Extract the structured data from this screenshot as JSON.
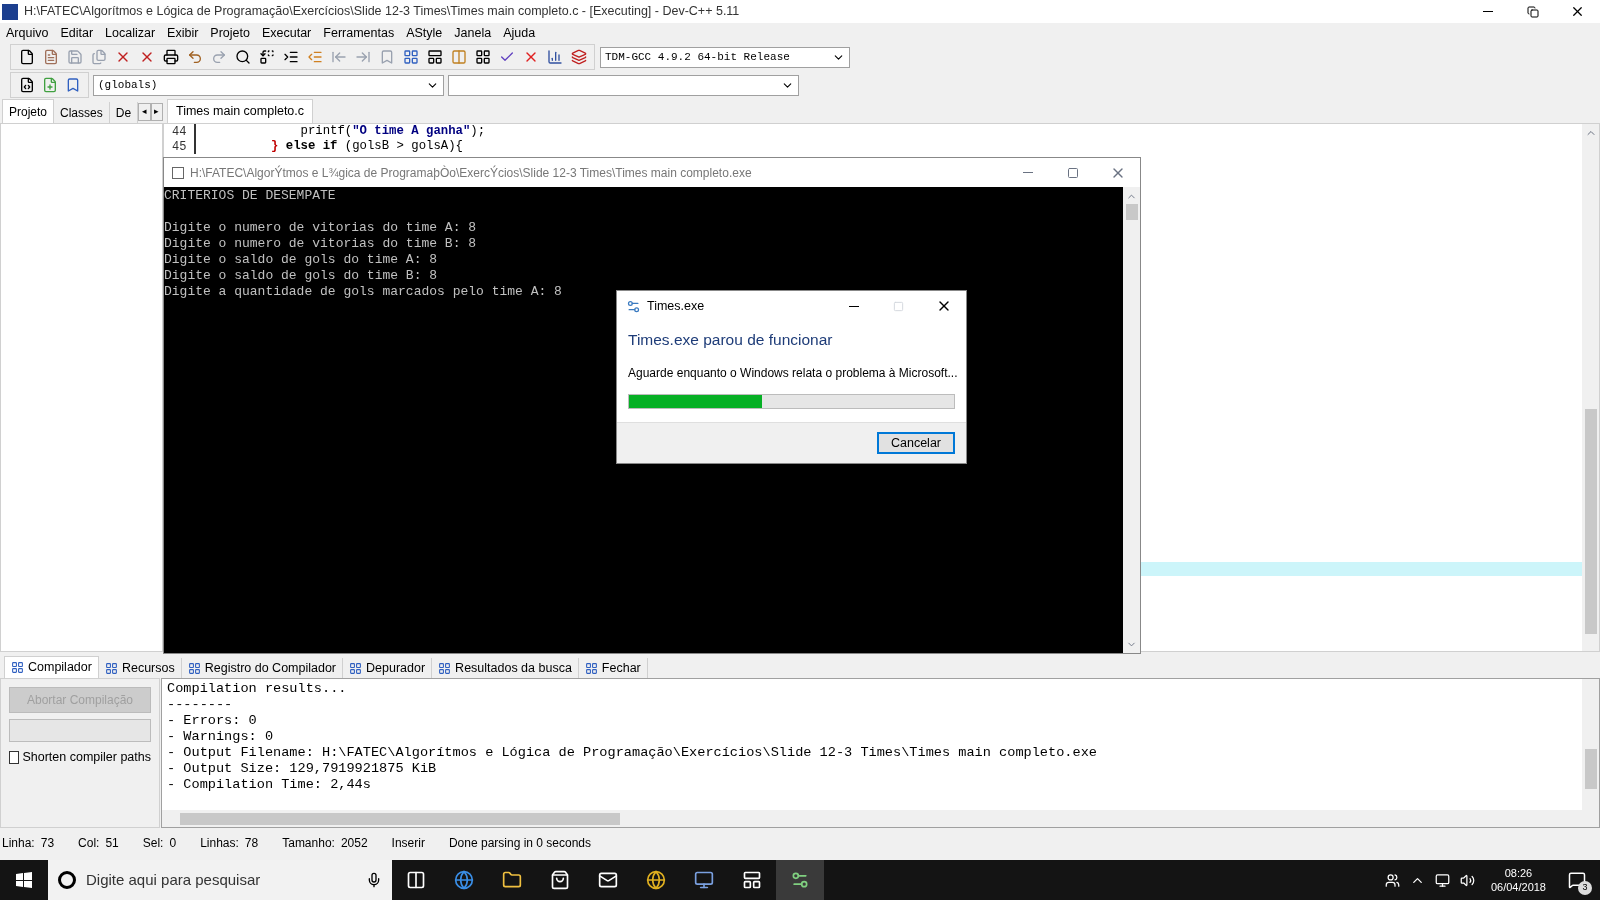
{
  "window": {
    "title": "H:\\FATEC\\Algorítmos e Lógica de Programação\\Exercícios\\Slide 12-3 Times\\Times main completo.c - [Executing] - Dev-C++ 5.11"
  },
  "menu": [
    "Arquivo",
    "Editar",
    "Localizar",
    "Exibir",
    "Projeto",
    "Executar",
    "Ferramentas",
    "AStyle",
    "Janela",
    "Ajuda"
  ],
  "compiler_select": {
    "value": "TDM-GCC 4.9.2 64-bit Release"
  },
  "scope_select": {
    "value": "(globals)"
  },
  "left_tabs": [
    {
      "label": "Projeto",
      "selected": true
    },
    {
      "label": "Classes",
      "selected": false
    },
    {
      "label": "De",
      "selected": false
    }
  ],
  "left_tab_arrows": [
    "◂",
    "▸"
  ],
  "editor_tab": {
    "label": "Times main completo.c"
  },
  "code_lines": [
    {
      "number": "44",
      "tokens": [
        {
          "text": "            printf(",
          "kind": "plain"
        },
        {
          "text": "\"O time A ganha\"",
          "kind": "string"
        },
        {
          "text": ");",
          "kind": "plain"
        }
      ]
    },
    {
      "number": "45",
      "tokens": [
        {
          "text": "        }",
          "kind": "brace"
        },
        {
          "text": " else if ",
          "kind": "keyword"
        },
        {
          "text": "(golsB > golsA){",
          "kind": "plain"
        }
      ]
    }
  ],
  "console": {
    "title": "H:\\FATEC\\AlgorÝtmos e L¾gica de ProgramaþÒo\\ExercÝcios\\Slide 12-3 Times\\Times main completo.exe",
    "heading": "CRITERIOS DE DESEMPATE",
    "lines": [
      "Digite o numero de vitorias do time A: 8",
      "Digite o numero de vitorias do time B: 8",
      "Digite o saldo de gols do time A: 8",
      "Digite o saldo de gols do time B: 8",
      "Digite a quantidade de gols marcados pelo time A: 8"
    ]
  },
  "dialog": {
    "title": "Times.exe",
    "heading": "Times.exe parou de funcionar",
    "message": "Aguarde enquanto o Windows relata o problema à Microsoft...",
    "progress": {
      "level": 0.41
    },
    "button": "Cancelar"
  },
  "bottom_tabs": [
    {
      "label": "Compilador",
      "selected": true
    },
    {
      "label": "Recursos",
      "selected": false
    },
    {
      "label": "Registro do Compilador",
      "selected": false
    },
    {
      "label": "Depurador",
      "selected": false
    },
    {
      "label": "Resultados da busca",
      "selected": false
    },
    {
      "label": "Fechar",
      "selected": false
    }
  ],
  "compiler_panel": {
    "progress": {
      "level": 0
    },
    "abort_button": {
      "label": "Abortar Compilação",
      "disabled": true
    },
    "shorten_paths": {
      "label": "Shorten compiler paths",
      "checked": false
    }
  },
  "compile_log": [
    "Compilation results...",
    "--------",
    "- Errors: 0",
    "- Warnings: 0",
    "- Output Filename: H:\\FATEC\\Algorítmos e Lógica de Programação\\Exercícios\\Slide 12-3 Times\\Times main completo.exe",
    "- Output Size: 129,7919921875 KiB",
    "- Compilation Time: 2,44s"
  ],
  "status_bar": [
    {
      "label": "Linha:",
      "value": "73"
    },
    {
      "label": "Col:",
      "value": "51"
    },
    {
      "label": "Sel:",
      "value": "0"
    },
    {
      "label": "Linhas:",
      "value": "78"
    },
    {
      "label": "Tamanho:",
      "value": "2052"
    },
    {
      "label": "Inserir"
    },
    {
      "label": "Done parsing in 0 seconds"
    }
  ],
  "taskbar": {
    "search_placeholder": "Digite aqui para pesquisar",
    "time": "08:26",
    "date": "06/04/2018",
    "notifications": "3"
  }
}
